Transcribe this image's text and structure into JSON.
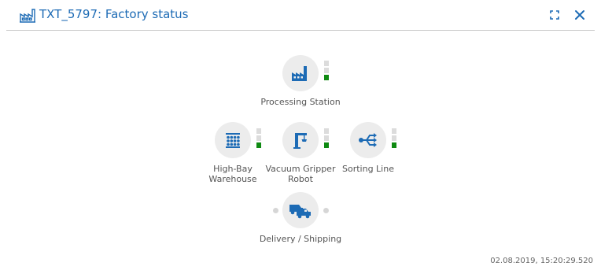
{
  "header": {
    "title": "TXT_5797: Factory status",
    "icon": "factory-icon",
    "buttons": [
      {
        "icon": "fullscreen-icon"
      },
      {
        "icon": "close-icon"
      }
    ]
  },
  "stations": {
    "processing": {
      "label": "Processing Station",
      "icon": "factory-icon",
      "lights": [
        "off",
        "off",
        "green"
      ]
    },
    "warehouse": {
      "label_line1": "High-Bay",
      "label_line2": "Warehouse",
      "icon": "warehouse-icon",
      "lights": [
        "off",
        "off",
        "green"
      ]
    },
    "gripper": {
      "label_line1": "Vacuum Gripper",
      "label_line2": "Robot",
      "icon": "crane-icon",
      "lights": [
        "off",
        "off",
        "green"
      ]
    },
    "sorting": {
      "label": "Sorting Line",
      "icon": "sorting-icon",
      "lights": [
        "off",
        "off",
        "green"
      ]
    },
    "delivery": {
      "label": "Delivery / Shipping",
      "icon": "truck-icon"
    }
  },
  "colors": {
    "accent": "#1d6bb5",
    "status_on": "#0f8a12",
    "status_off": "#dcdcdc"
  },
  "footer": {
    "timestamp": "02.08.2019, 15:20:29.520"
  }
}
